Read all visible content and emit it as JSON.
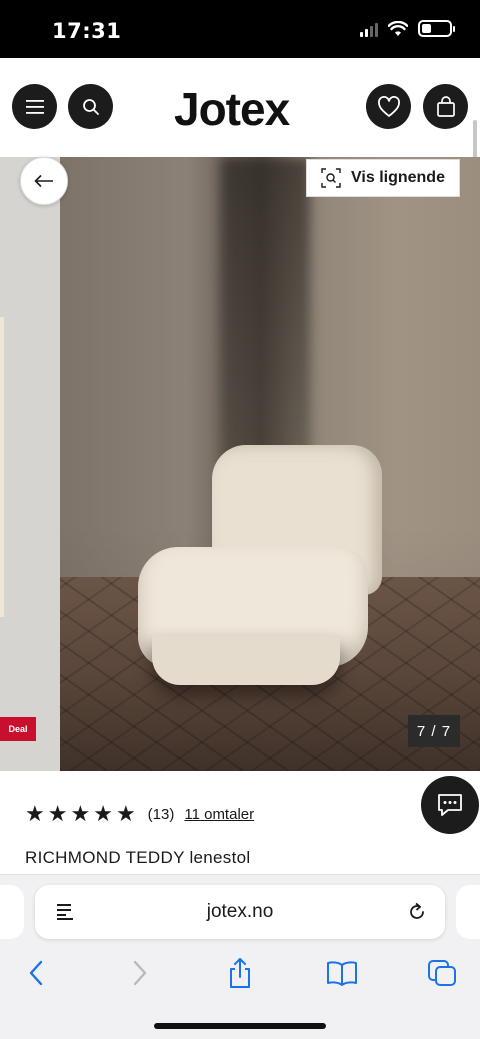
{
  "status_bar": {
    "time": "17:31"
  },
  "header": {
    "logo": "Jotex",
    "menu_icon": "hamburger-menu-icon",
    "search_icon": "search-icon",
    "wishlist_icon": "heart-icon",
    "cart_icon": "shopping-bag-icon"
  },
  "gallery": {
    "back_icon": "arrow-left-icon",
    "similar_label": "Vis lignende",
    "similar_icon": "visual-search-icon",
    "counter": "7 / 7",
    "deal_badge": "Deal"
  },
  "product": {
    "stars": 5,
    "rating_count": "(13)",
    "reviews_link": "11 omtaler",
    "title": "RICHMOND TEDDY lenestol",
    "chat_icon": "chat-bubble-icon"
  },
  "browser": {
    "url": "jotex.no",
    "nav": [
      "back",
      "forward",
      "share",
      "bookmarks",
      "tabs"
    ]
  },
  "colors": {
    "brand_dark": "#1c1c1c",
    "deal_red": "#c8102e",
    "ios_blue": "#1a73e8"
  }
}
